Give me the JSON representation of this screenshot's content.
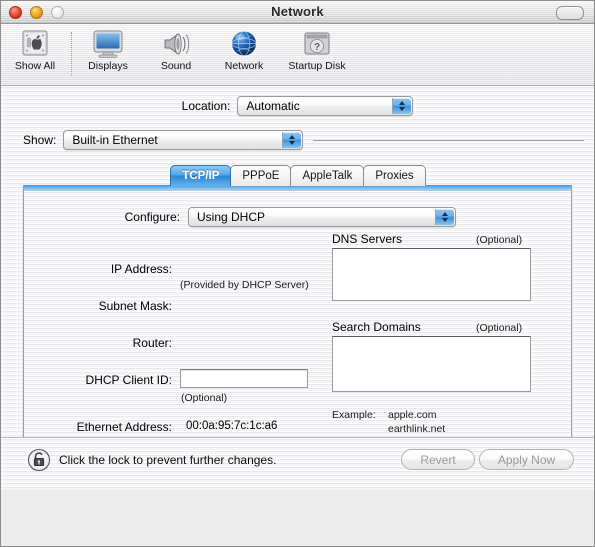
{
  "window": {
    "title": "Network",
    "controls": {
      "close": "close-button",
      "minimize": "minimize-button",
      "zoom": "zoom-button",
      "toolbar_toggle": "toolbar-toggle-button"
    }
  },
  "toolbar": {
    "items": [
      {
        "label": "Show All",
        "icon": "show-all-icon"
      },
      {
        "label": "Displays",
        "icon": "displays-icon"
      },
      {
        "label": "Sound",
        "icon": "sound-icon"
      },
      {
        "label": "Network",
        "icon": "network-globe-icon"
      },
      {
        "label": "Startup Disk",
        "icon": "startup-disk-icon"
      }
    ]
  },
  "location": {
    "label": "Location:",
    "value": "Automatic"
  },
  "show": {
    "label": "Show:",
    "value": "Built-in Ethernet"
  },
  "tabs": [
    {
      "label": "TCP/IP",
      "active": true
    },
    {
      "label": "PPPoE",
      "active": false
    },
    {
      "label": "AppleTalk",
      "active": false
    },
    {
      "label": "Proxies",
      "active": false
    }
  ],
  "tcpip": {
    "configure": {
      "label": "Configure:",
      "value": "Using DHCP"
    },
    "ip_address": {
      "label": "IP Address:",
      "value": "",
      "note": "(Provided by DHCP Server)"
    },
    "subnet_mask": {
      "label": "Subnet Mask:",
      "value": ""
    },
    "router": {
      "label": "Router:",
      "value": ""
    },
    "dhcp_client_id": {
      "label": "DHCP Client ID:",
      "value": "",
      "note": "(Optional)"
    },
    "ethernet_address": {
      "label": "Ethernet Address:",
      "value": "00:0a:95:7c:1c:a6"
    },
    "dns_servers": {
      "title": "DNS Servers",
      "optional": "(Optional)",
      "value": ""
    },
    "search_domains": {
      "title": "Search Domains",
      "optional": "(Optional)",
      "value": ""
    },
    "example": {
      "label": "Example:",
      "line1": "apple.com",
      "line2": "earthlink.net"
    }
  },
  "bottom": {
    "lock_icon": "unlocked-padlock-icon",
    "lock_text": "Click the lock to prevent further changes.",
    "revert_label": "Revert",
    "apply_label": "Apply Now"
  },
  "colors": {
    "accent_blue": "#3f8ed9",
    "tab_active_blue": "#2f86d8",
    "close_red": "#ee5f4a",
    "minimize_yellow": "#f7b230",
    "window_bg": "#eeeef2"
  }
}
